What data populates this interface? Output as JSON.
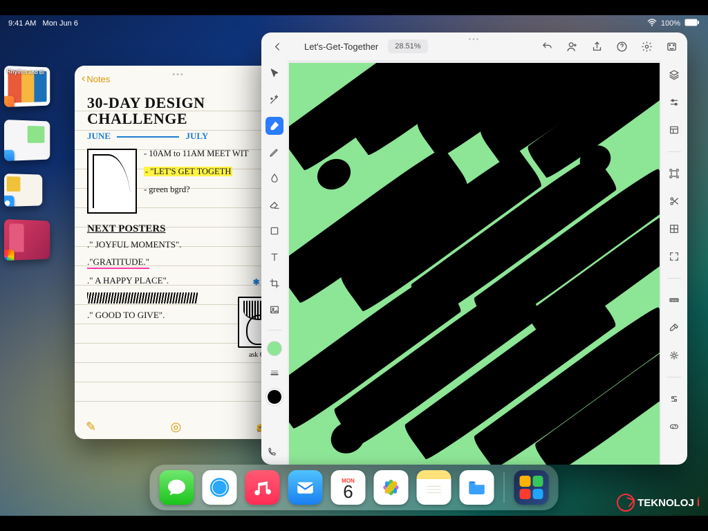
{
  "status": {
    "time": "9:41 AM",
    "date": "Mon Jun 6",
    "battery": "100%"
  },
  "stage_strip": {
    "items": [
      {
        "name": "books-thumb",
        "caption": "Rhythm and Bl"
      },
      {
        "name": "mail-thumb"
      },
      {
        "name": "safari-thumb"
      },
      {
        "name": "photos-thumb"
      }
    ]
  },
  "notes": {
    "back_label": "Notes",
    "title_line1": "30-DAY DESIGN",
    "title_line2": "CHALLENGE",
    "month_start": "JUNE",
    "month_end": "JULY",
    "bullets": [
      "- 10AM to 11AM MEET WIT",
      "- \"LET'S GET TOGETH",
      "- green bgrd?"
    ],
    "section": "NEXT POSTERS",
    "aside": "✱ post",
    "posters": [
      ".\" JOYFUL MOMENTS\".",
      ".\"GRATITUDE.\"",
      ".\" A HAPPY PLACE\".",
      "",
      ".\" GOOD TO GIVE\"."
    ],
    "ask": "ask Oliva"
  },
  "draw_app": {
    "doc_title": "Let's-Get-Together",
    "zoom": "28.51%",
    "swatches": {
      "a": "#8de596",
      "b": "#000000"
    },
    "left_tools": [
      "pointer",
      "wand",
      "brush",
      "pencil",
      "blend",
      "eraser",
      "shape",
      "text",
      "crop",
      "image",
      "swatch-a",
      "stroke",
      "swatch-b"
    ],
    "right_tools": [
      "layers",
      "adjust",
      "panels",
      "_sep",
      "transform",
      "cut",
      "grid",
      "fullscreen",
      "_sep",
      "ruler",
      "eyedropper",
      "settings-2",
      "_sep",
      "fx",
      "link"
    ]
  },
  "dock": {
    "calendar": {
      "dow": "MON",
      "day": "6"
    }
  },
  "watermark": {
    "text_a": "TEKNOLOJ",
    "text_b": "İ"
  }
}
